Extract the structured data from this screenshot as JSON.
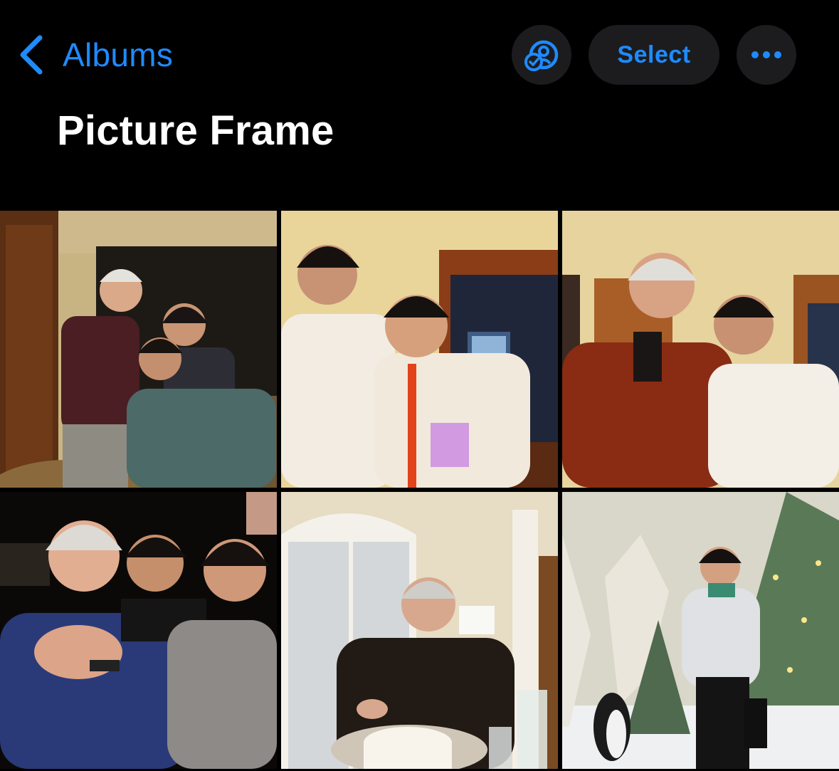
{
  "nav": {
    "back_label": "Albums",
    "select_label": "Select",
    "accent_color": "#1e8bff"
  },
  "album": {
    "title": "Picture Frame"
  },
  "photos": [
    {
      "id": "photo-1",
      "scene": "indoor-group-selfie"
    },
    {
      "id": "photo-2",
      "scene": "two-people-fleece"
    },
    {
      "id": "photo-3",
      "scene": "father-son-fleece"
    },
    {
      "id": "photo-4",
      "scene": "night-trio"
    },
    {
      "id": "photo-5",
      "scene": "birthday-cake-cutting"
    },
    {
      "id": "photo-6",
      "scene": "christmas-tree-winter"
    }
  ]
}
